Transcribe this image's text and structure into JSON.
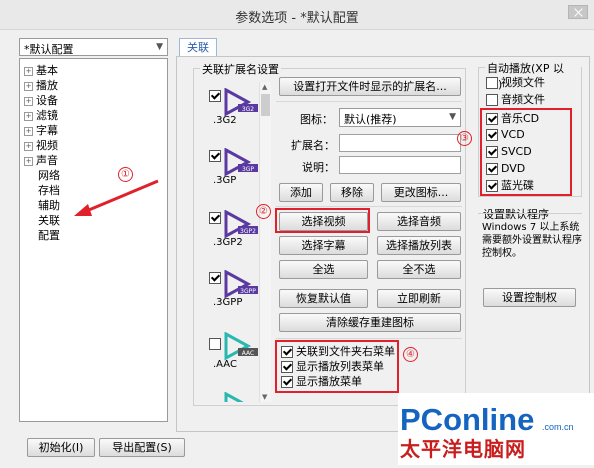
{
  "window": {
    "title": "参数选项 - *默认配置"
  },
  "profile": {
    "selected": "*默认配置"
  },
  "tree": [
    {
      "label": "基本",
      "expandable": true
    },
    {
      "label": "播放",
      "expandable": true
    },
    {
      "label": "设备",
      "expandable": true
    },
    {
      "label": "滤镜",
      "expandable": true
    },
    {
      "label": "字幕",
      "expandable": true
    },
    {
      "label": "视频",
      "expandable": true
    },
    {
      "label": "声音",
      "expandable": true
    },
    {
      "label": "网络",
      "expandable": false
    },
    {
      "label": "存档",
      "expandable": false
    },
    {
      "label": "辅助",
      "expandable": false
    },
    {
      "label": "关联",
      "expandable": false
    },
    {
      "label": "配置",
      "expandable": false
    }
  ],
  "tab": {
    "label": "关联"
  },
  "ext_group": {
    "label": "关联扩展名设置"
  },
  "extensions": [
    {
      "name": ".3G2",
      "tag": "3G2",
      "checked": true,
      "color": "#5a3aa0"
    },
    {
      "name": ".3GP",
      "tag": "3GP",
      "checked": true,
      "color": "#5a3aa0"
    },
    {
      "name": ".3GP2",
      "tag": "3GP2",
      "checked": true,
      "color": "#5a3aa0"
    },
    {
      "name": ".3GPP",
      "tag": "3GPP",
      "checked": true,
      "color": "#5a3aa0"
    },
    {
      "name": ".AAC",
      "tag": "AAC",
      "checked": false,
      "color": "#2ab7b0"
    }
  ],
  "buttons": {
    "set_display_ext": "设置打开文件时显示的扩展名...",
    "add": "添加",
    "remove": "移除",
    "change_icon": "更改图标...",
    "select_video": "选择视频",
    "select_audio": "选择音频",
    "select_subtitle": "选择字幕",
    "select_playlist": "选择播放列表",
    "select_all": "全选",
    "select_none": "全不选",
    "restore_default": "恢复默认值",
    "refresh_now": "立即刷新",
    "clear_icon_cache": "清除缓存重建图标",
    "set_control": "设置控制权",
    "initialize": "初始化(I)",
    "export_config": "导出配置(S)"
  },
  "form": {
    "icon_label": "图标：",
    "icon_value": "默认(推荐)",
    "ext_label": "扩展名：",
    "desc_label": "说明："
  },
  "context_options": [
    {
      "label": "关联到文件夹右菜单",
      "checked": true
    },
    {
      "label": "显示播放列表菜单",
      "checked": true
    },
    {
      "label": "显示播放菜单",
      "checked": true
    }
  ],
  "autoplay": {
    "label": "自动播放(XP 以上)",
    "items": [
      {
        "label": "视频文件",
        "checked": false
      },
      {
        "label": "音频文件",
        "checked": false
      },
      {
        "label": "音乐CD",
        "checked": true
      },
      {
        "label": "VCD",
        "checked": true
      },
      {
        "label": "SVCD",
        "checked": true
      },
      {
        "label": "DVD",
        "checked": true
      },
      {
        "label": "蓝光碟",
        "checked": true
      }
    ]
  },
  "default_program": {
    "label": "设置默认程序",
    "note": "Windows 7 以上系统需要额外设置默认程序控制权。"
  },
  "annotations": [
    "①",
    "②",
    "③",
    "④"
  ],
  "watermark": {
    "brand": "PConline",
    "domain": ".com.cn",
    "subtitle": "太平洋电脑网"
  },
  "colors": {
    "highlight": "#e0202a",
    "brand_blue": "#1565c0",
    "subtitle_red": "#c81e1e"
  }
}
